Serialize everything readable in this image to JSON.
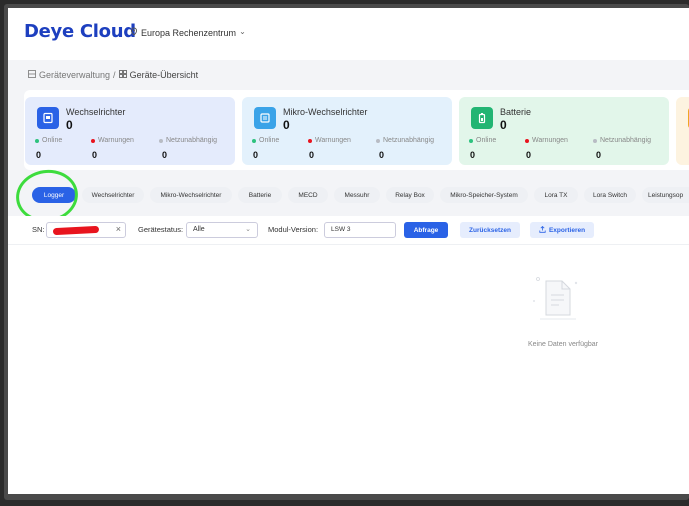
{
  "app": {
    "logo_text": "Deye Cloud",
    "datacenter": "Europa Rechenzentrum",
    "datacenter_chevron": "⌄"
  },
  "breadcrumb": {
    "root": "Geräteverwaltung",
    "separator": "/",
    "current": "Geräte-Übersicht"
  },
  "cards": [
    {
      "title": "Wechselrichter",
      "count": "0",
      "color": "#2a62e6",
      "icon": "inverter-icon",
      "stats": [
        {
          "label": "Online",
          "value": "0",
          "color": "#2ec27e"
        },
        {
          "label": "Warnungen",
          "value": "0",
          "color": "#e8141e"
        },
        {
          "label": "Netzunabhängig",
          "value": "0",
          "color": "#b8bcc4"
        }
      ]
    },
    {
      "title": "Mikro-Wechselrichter",
      "count": "0",
      "color": "#3aa3e8",
      "icon": "micro-inverter-icon",
      "stats": [
        {
          "label": "Online",
          "value": "0",
          "color": "#2ec27e"
        },
        {
          "label": "Warnungen",
          "value": "0",
          "color": "#e8141e"
        },
        {
          "label": "Netzunabhängig",
          "value": "0",
          "color": "#b8bcc4"
        }
      ]
    },
    {
      "title": "Batterie",
      "count": "0",
      "color": "#22b573",
      "icon": "battery-icon",
      "stats": [
        {
          "label": "Online",
          "value": "0",
          "color": "#2ec27e"
        },
        {
          "label": "Warnungen",
          "value": "0",
          "color": "#e8141e"
        },
        {
          "label": "Netzunabhängig",
          "value": "0",
          "color": "#b8bcc4"
        }
      ]
    }
  ],
  "tabs": [
    "Logger",
    "Wechselrichter",
    "Mikro-Wechselrichter",
    "Batterie",
    "MECD",
    "Messuhr",
    "Relay Box",
    "Mikro-Speicher-System",
    "Lora TX",
    "Lora Switch",
    "Leistungsop"
  ],
  "active_tab": "Logger",
  "filters": {
    "sn_label": "SN:",
    "sn_clear": "×",
    "status_label": "Gerätestatus:",
    "status_value": "Alle",
    "modul_label": "Modul-Version:",
    "modul_value": "LSW 3",
    "query_button": "Abfrage",
    "reset_button": "Zurücksetzen",
    "export_button": "Exportieren"
  },
  "empty": {
    "text": "Keine Daten verfügbar"
  }
}
